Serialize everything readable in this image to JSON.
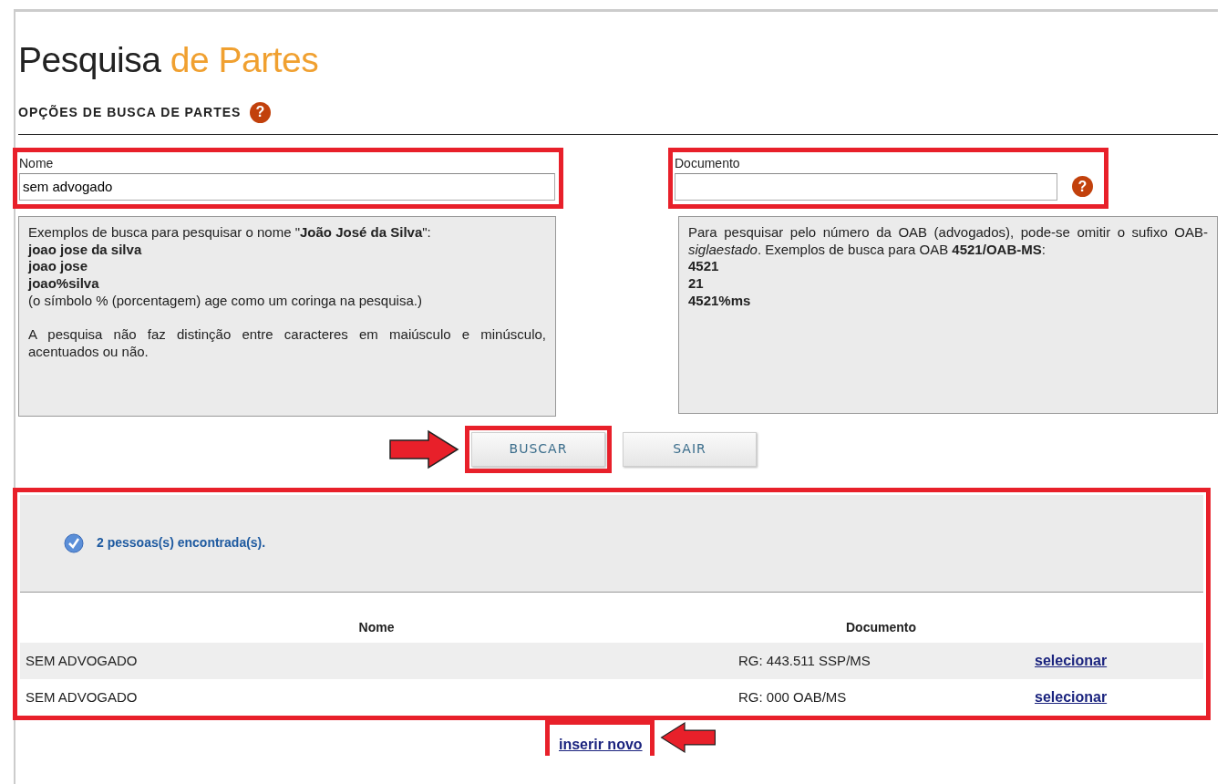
{
  "title": {
    "main": "Pesquisa",
    "accent": "de Partes"
  },
  "section": {
    "heading": "OPÇÕES DE BUSCA DE PARTES",
    "help_glyph": "?"
  },
  "fields": [
    {
      "label": "Nome",
      "value": "sem advogado",
      "highlighted": true
    },
    {
      "label": "Documento",
      "help_glyph": "?",
      "highlighted": true
    }
  ],
  "help_boxes": [
    [
      {
        "kind": "text",
        "text": "Exemplos de busca para pesquisar o nome \"**João José da Silva**\":"
      },
      {
        "kind": "example",
        "text": "joao jose da silva"
      },
      {
        "kind": "example",
        "text": "joao jose"
      },
      {
        "kind": "example",
        "text": "joao%silva"
      },
      {
        "kind": "text",
        "text": "(o símbolo % (porcentagem) age como um coringa na pesquisa.)"
      },
      {
        "kind": "paragraph",
        "text": "A pesquisa não faz distinção entre caracteres em maiúsculo e minúsculo, acentuados ou não."
      }
    ],
    [
      {
        "kind": "text",
        "text": "Para pesquisar pelo número da OAB (advogados), pode-se omitir o sufixo OAB-*siglaestado*. Exemplos de busca para OAB **4521/OAB-MS**:"
      },
      {
        "kind": "example",
        "text": "4521"
      },
      {
        "kind": "example",
        "text": "21"
      },
      {
        "kind": "example",
        "text": "4521%ms"
      }
    ]
  ],
  "buttons": [
    {
      "label": "BUSCAR",
      "highlighted": true,
      "arrow": true
    },
    {
      "label": "SAIR",
      "highlighted": false,
      "arrow": false
    }
  ],
  "results": {
    "highlighted": true,
    "message": "2 pessoas(s) encontrada(s).",
    "columns": [
      "Nome",
      "Documento"
    ],
    "rows": [
      {
        "nome": "SEM ADVOGADO",
        "documento": "RG: 443.511 SSP/MS",
        "action": "selecionar"
      },
      {
        "nome": "SEM ADVOGADO",
        "documento": "RG: 000 OAB/MS",
        "action": "selecionar"
      }
    ]
  },
  "insert_link": {
    "label": "inserir novo",
    "highlighted": true,
    "arrow": true
  }
}
